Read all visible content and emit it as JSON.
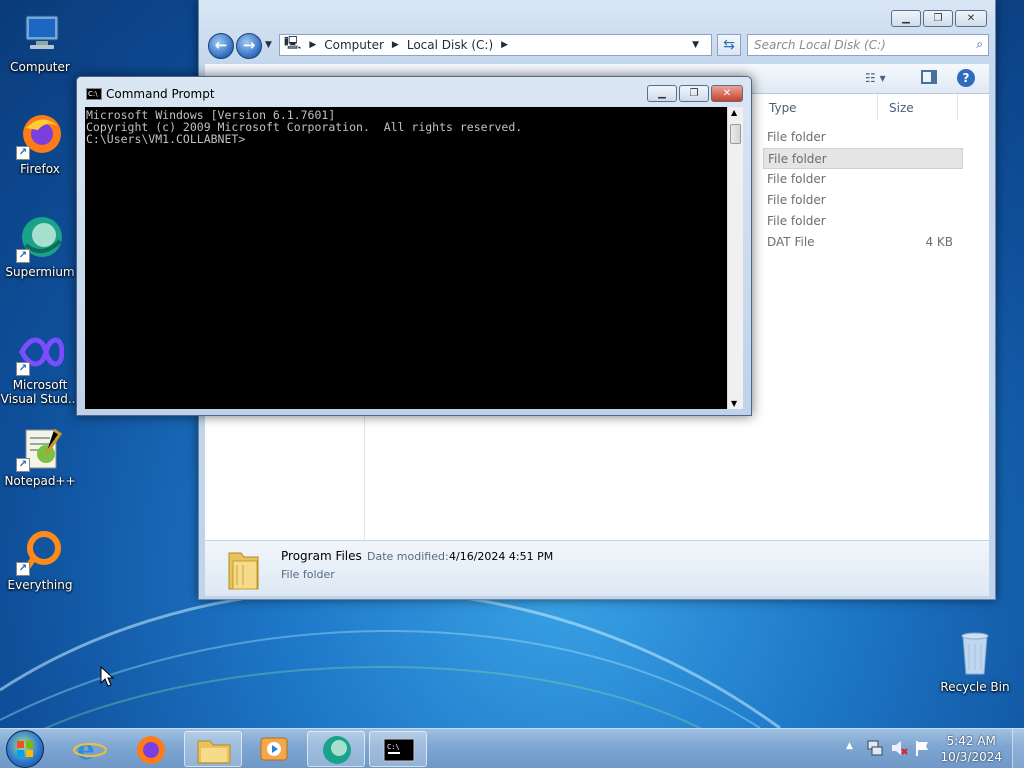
{
  "desktop": {
    "icons": [
      {
        "label": "Computer",
        "icon": "computer-icon"
      },
      {
        "label": "Firefox",
        "icon": "firefox-icon"
      },
      {
        "label": "Supermium",
        "icon": "supermium-icon"
      },
      {
        "label": "Microsoft Visual Stud...",
        "icon": "visual-studio-icon"
      },
      {
        "label": "Notepad++",
        "icon": "notepadpp-icon"
      },
      {
        "label": "Everything",
        "icon": "everything-icon"
      },
      {
        "label": "Recycle Bin",
        "icon": "recycle-bin-icon"
      }
    ]
  },
  "explorer": {
    "breadcrumb": [
      "Computer",
      "Local Disk (C:)"
    ],
    "search_placeholder": "Search Local Disk (C:)",
    "columns": {
      "type": "Type",
      "size": "Size"
    },
    "rows": [
      {
        "type": "File folder",
        "size": ""
      },
      {
        "type": "File folder",
        "size": ""
      },
      {
        "type": "File folder",
        "size": ""
      },
      {
        "type": "File folder",
        "size": ""
      },
      {
        "type": "File folder",
        "size": ""
      },
      {
        "type": "DAT File",
        "size": "4 KB"
      }
    ],
    "selected_row": 1,
    "details": {
      "name": "Program Files",
      "date_label": "Date modified:",
      "date_value": "4/16/2024 4:51 PM",
      "kind": "File folder"
    }
  },
  "cmd": {
    "title": "Command Prompt",
    "lines": [
      "Microsoft Windows [Version 6.1.7601]",
      "Copyright (c) 2009 Microsoft Corporation.  All rights reserved.",
      "",
      "C:\\Users\\VM1.COLLABNET>"
    ]
  },
  "taskbar": {
    "items": [
      "start-orb",
      "internet-explorer",
      "firefox",
      "explorer",
      "media-player",
      "supermium",
      "command-prompt"
    ],
    "clock_time": "5:42 AM",
    "clock_date": "10/3/2024"
  },
  "colors": {
    "desktop": "#1e78c8",
    "taskbar": "#7ea6d2",
    "console_bg": "#000000",
    "console_fg": "#c0c0c0"
  }
}
